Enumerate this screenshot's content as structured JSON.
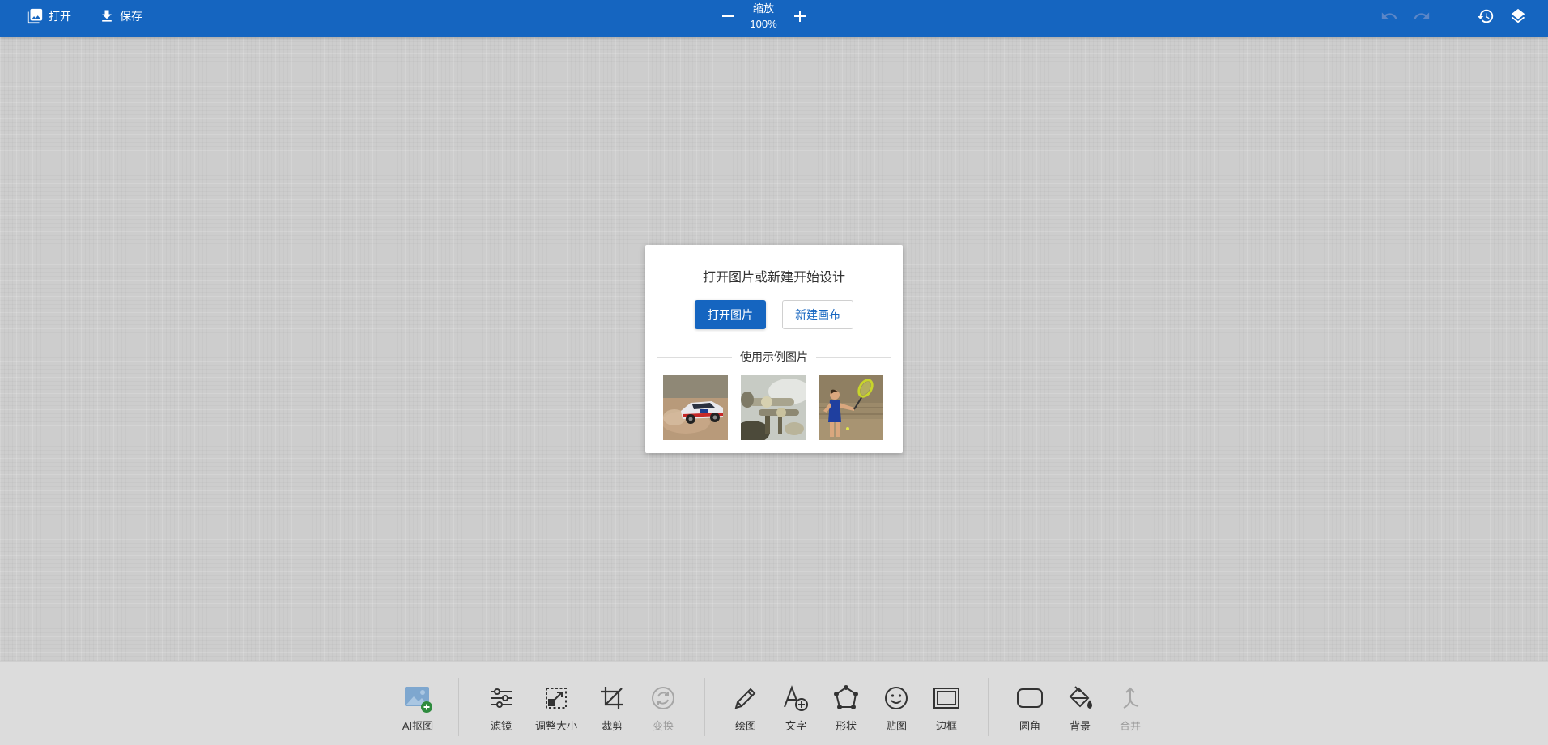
{
  "topbar": {
    "open_label": "打开",
    "save_label": "保存",
    "zoom_title": "缩放",
    "zoom_value": "100%",
    "accent_color": "#1565c0"
  },
  "dialog": {
    "title": "打开图片或新建开始设计",
    "open_button": "打开图片",
    "new_button": "新建画布",
    "samples_label": "使用示例图片",
    "samples": [
      {
        "name": "rally-car"
      },
      {
        "name": "brass-instrument"
      },
      {
        "name": "tennis-player"
      }
    ]
  },
  "toolbar": {
    "tools": [
      {
        "id": "ai-cutout",
        "label": "AI抠图",
        "icon": "image-plus-icon",
        "enabled": true
      },
      {
        "id": "filter",
        "label": "滤镜",
        "icon": "sliders-icon",
        "enabled": true
      },
      {
        "id": "resize",
        "label": "调整大小",
        "icon": "resize-icon",
        "enabled": true
      },
      {
        "id": "crop",
        "label": "裁剪",
        "icon": "crop-icon",
        "enabled": true
      },
      {
        "id": "transform",
        "label": "变换",
        "icon": "rotate-icon",
        "enabled": false
      },
      {
        "id": "draw",
        "label": "绘图",
        "icon": "pencil-icon",
        "enabled": true
      },
      {
        "id": "text",
        "label": "文字",
        "icon": "text-add-icon",
        "enabled": true
      },
      {
        "id": "shape",
        "label": "形状",
        "icon": "polygon-icon",
        "enabled": true
      },
      {
        "id": "sticker",
        "label": "贴图",
        "icon": "smiley-icon",
        "enabled": true
      },
      {
        "id": "frame",
        "label": "边框",
        "icon": "frame-icon",
        "enabled": true
      },
      {
        "id": "corners",
        "label": "圆角",
        "icon": "rounded-rect-icon",
        "enabled": true
      },
      {
        "id": "background",
        "label": "背景",
        "icon": "paint-bucket-icon",
        "enabled": true
      },
      {
        "id": "merge",
        "label": "合并",
        "icon": "merge-icon",
        "enabled": false
      }
    ]
  }
}
